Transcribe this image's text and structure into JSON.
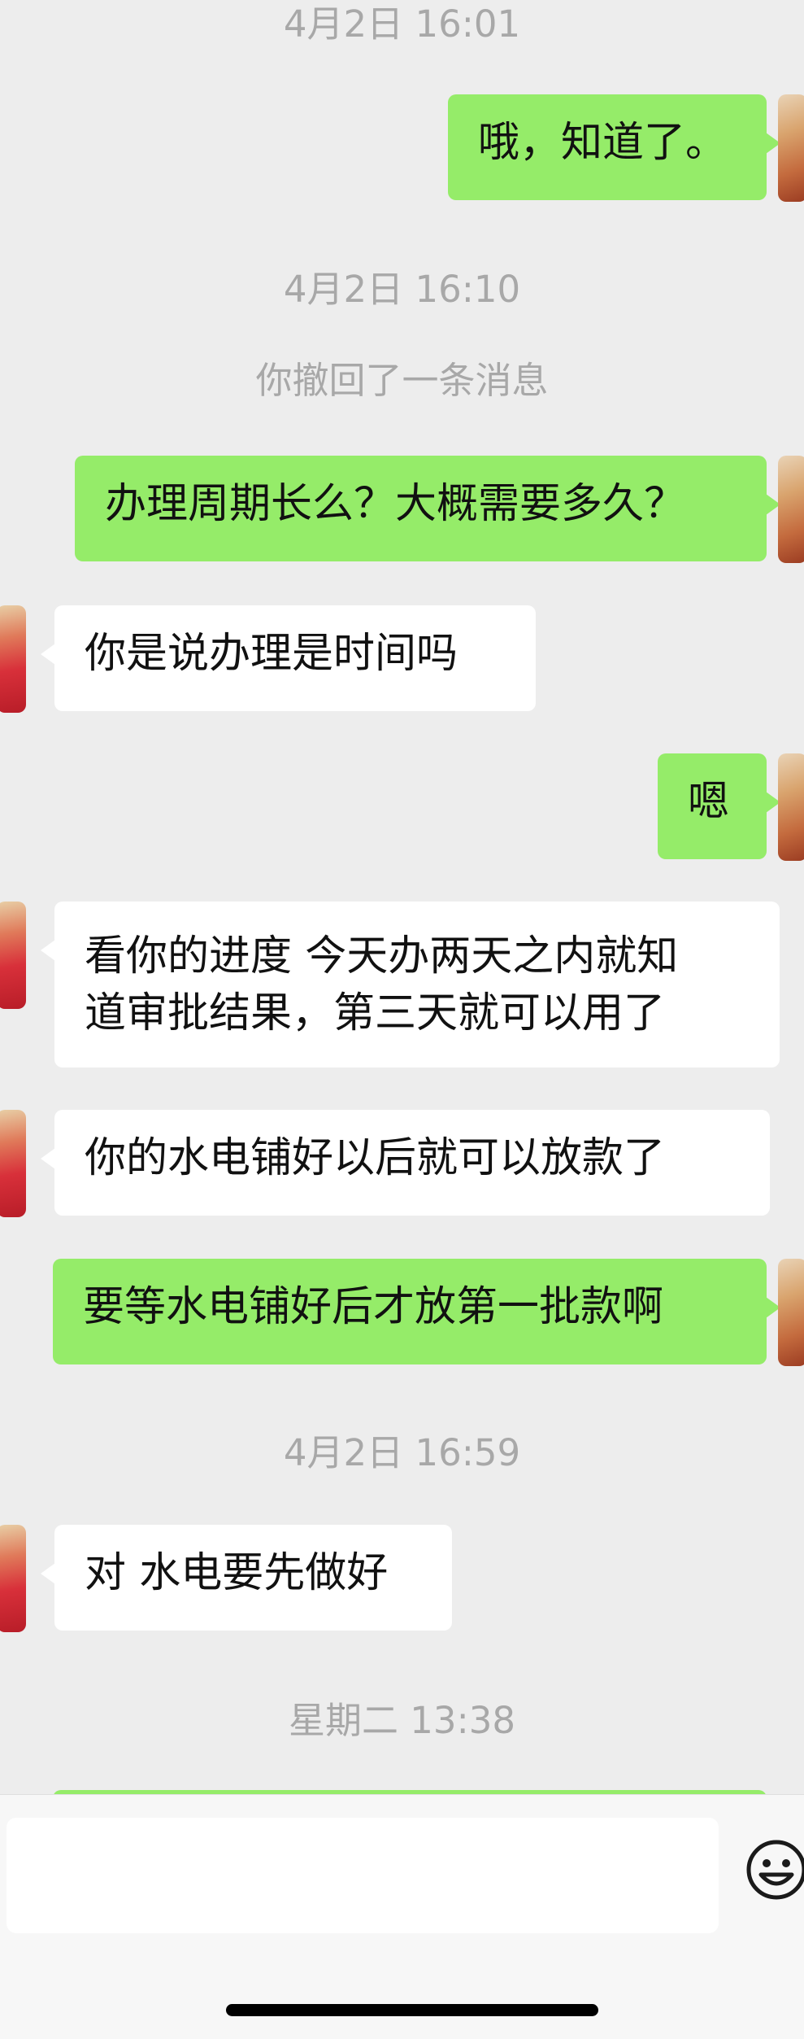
{
  "messages": [
    {
      "type": "timestamp",
      "text": "4月2日 16:01"
    },
    {
      "type": "outgoing",
      "text": "哦，知道了。"
    },
    {
      "type": "timestamp",
      "text": "4月2日 16:10"
    },
    {
      "type": "system",
      "text": "你撤回了一条消息"
    },
    {
      "type": "outgoing",
      "text": "办理周期长么？大概需要多久？"
    },
    {
      "type": "incoming",
      "text": "你是说办理是时间吗"
    },
    {
      "type": "outgoing",
      "text": "嗯"
    },
    {
      "type": "incoming",
      "lines": [
        "看你的进度 今天办两天之内就知",
        "道审批结果，第三天就可以用了"
      ]
    },
    {
      "type": "incoming",
      "text": "你的水电铺好以后就可以放款了"
    },
    {
      "type": "outgoing",
      "text": "要等水电铺好后才放第一批款啊"
    },
    {
      "type": "timestamp",
      "text": "4月2日 16:59"
    },
    {
      "type": "incoming",
      "text": "对 水电要先做好"
    },
    {
      "type": "timestamp",
      "text": "星期二 13:38"
    }
  ],
  "input": {
    "value": ""
  },
  "icons": {
    "emoji": "emoji-smile-icon"
  }
}
